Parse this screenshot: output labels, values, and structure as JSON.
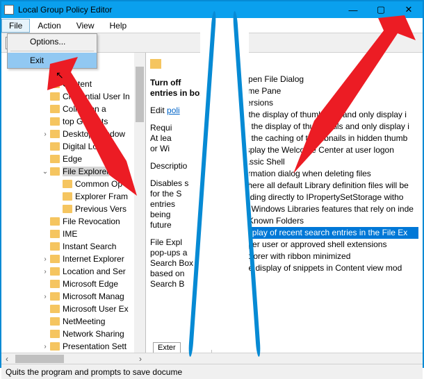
{
  "title": "Local Group Policy Editor",
  "menus": {
    "file": "File",
    "action": "Action",
    "view": "View",
    "help": "Help"
  },
  "file_menu": {
    "options": "Options...",
    "exit": "Exit"
  },
  "tree": {
    "selected": "File Explorer",
    "d1": [
      "Content",
      "Credential User In",
      "Collection a",
      "top Gadgets",
      "Desktop Window",
      "Digital Locker",
      "Edge"
    ],
    "sel": "File Explorer",
    "d2": [
      "Common Op",
      "Explorer Fram",
      "Previous Vers"
    ],
    "d1b": [
      "File Revocation",
      "IME",
      "Instant Search",
      "Internet Explorer",
      "Location and Ser",
      "Microsoft Edge",
      "Microsoft Manag",
      "Microsoft User Ex",
      "NetMeeting",
      "Network Sharing",
      "Presentation Sett"
    ]
  },
  "mid": {
    "heading": "Turn off entries in box",
    "edit_prefix": "Edit ",
    "edit_link": "poli",
    "req": "Requi",
    "req2": "At lea",
    "req3": "or Wi",
    "desc_h": "Descriptio",
    "d1": "Disables s",
    "d2": "for the S",
    "d3": "entries",
    "d4": "being",
    "d5": "future",
    "f1": "File Expl",
    "f2": "pop-ups a",
    "f3": "Search Box",
    "f4": "based on",
    "f5": "Search B",
    "tab": "Exter"
  },
  "right": {
    "lines": [
      "on Open File Dialog",
      "r Frame Pane",
      "us Versions",
      "n off the display of thumbnails and only display i",
      "rn off the display of thumbnails and only display i",
      "rn off the caching of thumbnails in hidden thumb",
      "ot display the Welcome Center at user logon",
      "n Classic Shell",
      "confirmation dialog when deleting files",
      "on where all default Library definition files will be",
      "le binding directly to IPropertySetStorage witho",
      "rn off Windows Libraries features that rely on inde",
      "able Known Folders"
    ],
    "selected": "off display of recent search entries in the File Ex",
    "lines_after": [
      "only per user or approved shell extensions",
      "e Explorer with ribbon minimized",
      "off the display of snippets in Content view mod"
    ]
  },
  "status": "Quits the program and prompts to save docume"
}
